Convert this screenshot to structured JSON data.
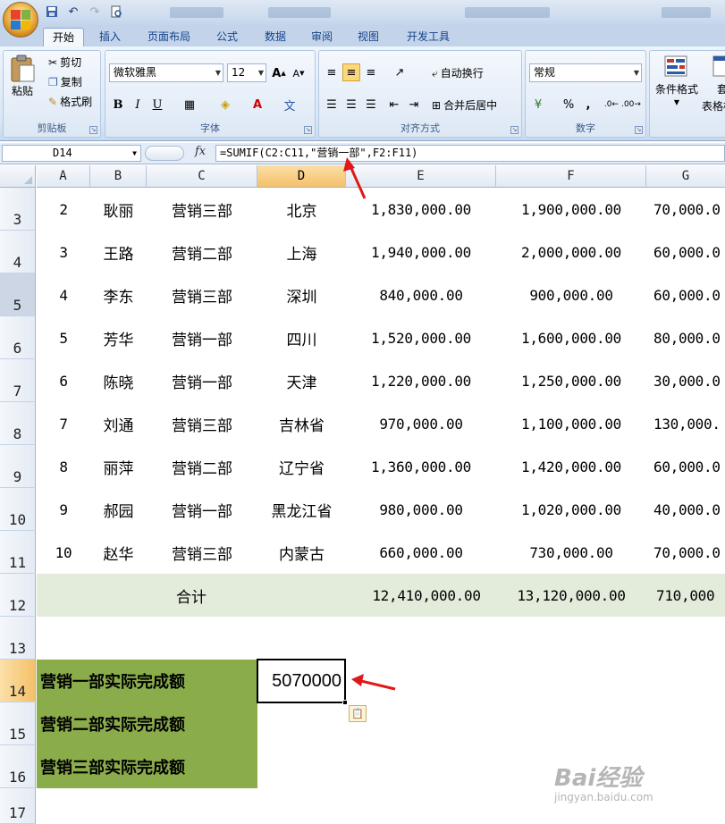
{
  "quick_access": {
    "icons": [
      "save-icon",
      "undo-icon",
      "redo-icon",
      "print-preview-icon"
    ]
  },
  "tabs": [
    "开始",
    "插入",
    "页面布局",
    "公式",
    "数据",
    "审阅",
    "视图",
    "开发工具"
  ],
  "ribbon": {
    "clipboard": {
      "paste": "粘贴",
      "cut": "剪切",
      "copy": "复制",
      "format_painter": "格式刷",
      "label": "剪贴板"
    },
    "font": {
      "family": "微软雅黑",
      "size": "12",
      "bold": "B",
      "italic": "I",
      "underline": "U",
      "label": "字体"
    },
    "alignment": {
      "wrap": "自动换行",
      "merge": "合并后居中",
      "label": "对齐方式"
    },
    "number": {
      "format": "常规",
      "percent": "%",
      "comma": ",",
      "label": "数字"
    },
    "styles": {
      "conditional": "条件格式",
      "table_partial": "套",
      "table_partial2": "表格样"
    }
  },
  "formula_bar": {
    "name_box": "D14",
    "fx": "fx",
    "formula": "=SUMIF(C2:C11,\"营销一部\",F2:F11)"
  },
  "columns": [
    "A",
    "B",
    "C",
    "D",
    "E",
    "F",
    "G"
  ],
  "rows": [
    {
      "num": "3",
      "cells": [
        "2",
        "耿丽",
        "营销三部",
        "北京",
        "1,830,000.00",
        "1,900,000.00",
        "70,000.0"
      ]
    },
    {
      "num": "4",
      "cells": [
        "3",
        "王路",
        "营销二部",
        "上海",
        "1,940,000.00",
        "2,000,000.00",
        "60,000.0"
      ]
    },
    {
      "num": "5",
      "cells": [
        "4",
        "李东",
        "营销三部",
        "深圳",
        "840,000.00",
        "900,000.00",
        "60,000.0"
      ]
    },
    {
      "num": "6",
      "cells": [
        "5",
        "芳华",
        "营销一部",
        "四川",
        "1,520,000.00",
        "1,600,000.00",
        "80,000.0"
      ]
    },
    {
      "num": "7",
      "cells": [
        "6",
        "陈晓",
        "营销一部",
        "天津",
        "1,220,000.00",
        "1,250,000.00",
        "30,000.0"
      ]
    },
    {
      "num": "8",
      "cells": [
        "7",
        "刘通",
        "营销三部",
        "吉林省",
        "970,000.00",
        "1,100,000.00",
        "130,000."
      ]
    },
    {
      "num": "9",
      "cells": [
        "8",
        "丽萍",
        "营销二部",
        "辽宁省",
        "1,360,000.00",
        "1,420,000.00",
        "60,000.0"
      ]
    },
    {
      "num": "10",
      "cells": [
        "9",
        "郝园",
        "营销一部",
        "黑龙江省",
        "980,000.00",
        "1,020,000.00",
        "40,000.0"
      ]
    },
    {
      "num": "11",
      "cells": [
        "10",
        "赵华",
        "营销三部",
        "内蒙古",
        "660,000.00",
        "730,000.00",
        "70,000.0"
      ]
    }
  ],
  "total_row": {
    "num": "12",
    "label": "合计",
    "e": "12,410,000.00",
    "f": "13,120,000.00",
    "g": "710,000"
  },
  "extra_rows": [
    "13",
    "14",
    "15",
    "16",
    "17"
  ],
  "summary": {
    "dept1_label": "营销一部实际完成额",
    "dept2_label": "营销二部实际完成额",
    "dept3_label": "营销三部实际完成额",
    "dept1_value": "5070000"
  },
  "watermark": {
    "main": "Bai经验",
    "sub": "jingyan.baidu.com"
  }
}
